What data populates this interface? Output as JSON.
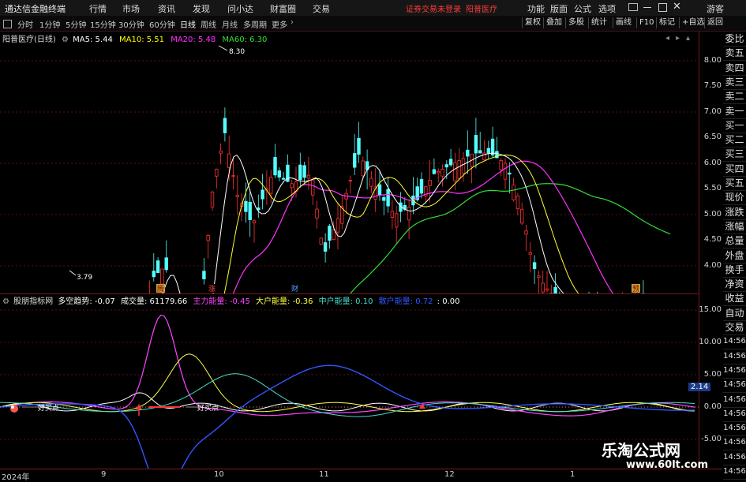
{
  "menubar": {
    "app_title": "通达信金融终端",
    "menu": [
      "行情",
      "市场",
      "资讯",
      "发现",
      "问小达",
      "财富圈",
      "交易"
    ],
    "warning": "证券交易未登录",
    "stock_name": "阳普医疗",
    "right_menu": [
      "功能",
      "版面",
      "公式",
      "选项"
    ],
    "guest": "游客"
  },
  "periodbar": {
    "periods": [
      "分时",
      "1分钟",
      "5分钟",
      "15分钟",
      "30分钟",
      "60分钟",
      "日线",
      "周线",
      "月线",
      "多周期",
      "更多"
    ],
    "selected": "日线",
    "tools": [
      "复权",
      "叠加",
      "多股",
      "统计",
      "画线",
      "F10",
      "标记",
      "+自选",
      "返回"
    ]
  },
  "main_info": {
    "title": "阳普医疗(日线)",
    "ma": [
      {
        "label": "MA5: 5.44",
        "color": "#ffffff"
      },
      {
        "label": "MA10: 5.51",
        "color": "#ffff00"
      },
      {
        "label": "MA20: 5.48",
        "color": "#ff33ff"
      },
      {
        "label": "MA60: 6.30",
        "color": "#33dd33"
      }
    ],
    "high_label": "8.30",
    "low_label": "3.79",
    "markers": [
      "腾",
      "涨",
      "财",
      "预"
    ]
  },
  "price_axis": [
    "8.00",
    "7.50",
    "7.00",
    "6.50",
    "6.00",
    "5.50",
    "5.00",
    "4.50",
    "4.00"
  ],
  "ind_info": {
    "name": "股朋指标网",
    "items": [
      {
        "label": "多空趋势: -0.07",
        "color": "#ffffff"
      },
      {
        "label": "成交量: 61179.66",
        "color": "#ffffff"
      },
      {
        "label": "主力能量: -0.45",
        "color": "#ff44ff"
      },
      {
        "label": "大户能量: -0.36",
        "color": "#ffff44"
      },
      {
        "label": "中户能量: 0.10",
        "color": "#44ddcc"
      },
      {
        "label": "散户能量: 0.72",
        "color": "#3355ff"
      },
      {
        "label": ": 0.00",
        "color": "#ffffff"
      }
    ],
    "buy_label_1": "好买点",
    "buy_label_2": "好买点",
    "right_value": "2.14"
  },
  "ind_axis": [
    "15.00",
    "10.00",
    "5.00",
    "0.00",
    "-5.00"
  ],
  "side_panel": [
    "委比",
    "卖五",
    "卖四",
    "卖三",
    "卖二",
    "卖一",
    "买一",
    "买二",
    "买三",
    "买四",
    "买五",
    "现价",
    "涨跌",
    "涨幅",
    "总量",
    "外盘",
    "换手",
    "净资",
    "收益",
    "自动",
    "交易",
    "14:56",
    "14:56",
    "14:56",
    "14:56",
    "14:56",
    "14:56",
    "14:56",
    "14:56",
    "14:56",
    "14:56"
  ],
  "x_axis": [
    "2024年",
    "9",
    "10",
    "11",
    "12",
    "1"
  ],
  "watermark": {
    "title": "乐淘公式网",
    "site": "www.60lt.com"
  }
}
